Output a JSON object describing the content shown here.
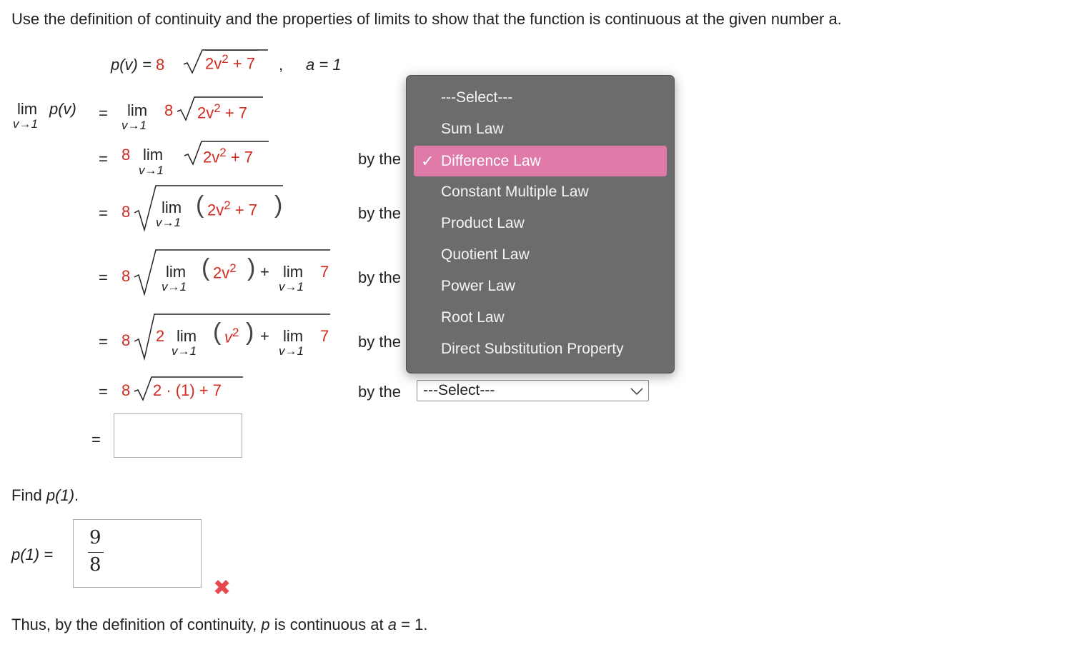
{
  "instructions": {
    "text": "Use the definition of continuity and the properties of limits to show that the function is continuous at the given number a."
  },
  "problem": {
    "func": "p(v) = ",
    "coef": "8",
    "radicand_a": "2v",
    "radicand_exp": "2",
    "radicand_b": " + 7",
    "comma": ",",
    "a_label": "a = 1"
  },
  "math": {
    "lim": "lim",
    "v_to_1": "v→1",
    "eq": "=",
    "pv": "p(v)",
    "eight": "8",
    "two": "2",
    "seven": "7",
    "plus7": "+ 7",
    "plus": "+",
    "two_v": "2v",
    "v": "v",
    "exp2": "2",
    "final_radicand": "2 · (1) + 7"
  },
  "steps": {
    "by_the": "by the"
  },
  "dropdown": {
    "options": [
      "---Select---",
      "Sum Law",
      "Difference Law",
      "Constant Multiple Law",
      "Product Law",
      "Quotient Law",
      "Power Law",
      "Root Law",
      "Direct Substitution Property"
    ],
    "selected_label": "Difference Law",
    "check": "✓"
  },
  "last_select": {
    "value": "---Select---"
  },
  "find": {
    "title_prefix": "Find ",
    "title_expr": "p(1)",
    "title_suffix": ".",
    "label": "p(1) =",
    "numerator": "9",
    "denominator": "8",
    "status_icon": "✖"
  },
  "conclusion": {
    "part1": "Thus, by the definition of continuity, ",
    "p": "p",
    "part2": " is continuous at ",
    "a": "a",
    "part3": " = 1."
  }
}
